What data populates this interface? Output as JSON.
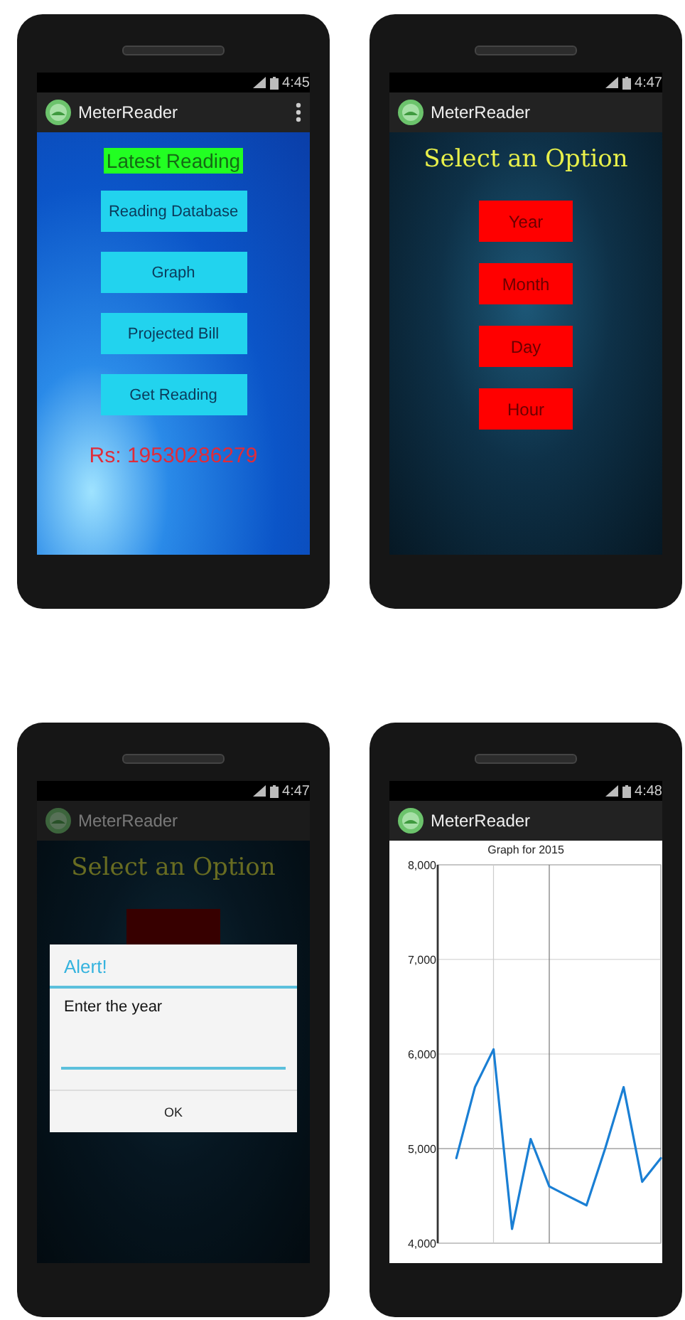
{
  "phones": [
    {
      "kind": "menu",
      "status_time": "4:45",
      "app_title": "MeterReader",
      "overflow_menu": true,
      "heading": "Latest Reading",
      "buttons": [
        "Reading Database",
        "Graph",
        "Projected Bill",
        "Get Reading"
      ],
      "reading": "Rs: 19530286279"
    },
    {
      "kind": "options",
      "status_time": "4:47",
      "app_title": "MeterReader",
      "overflow_menu": false,
      "heading": "Select an Option",
      "options": [
        "Year",
        "Month",
        "Day",
        "Hour"
      ]
    },
    {
      "kind": "dialog",
      "status_time": "4:47",
      "app_title": "MeterReader",
      "overflow_menu": false,
      "dimmed": true,
      "heading": "Select an Option",
      "dialog": {
        "title": "Alert!",
        "message": "Enter the year",
        "button": "OK"
      }
    },
    {
      "kind": "graph",
      "status_time": "4:48",
      "app_title": "MeterReader",
      "overflow_menu": false,
      "chart_data": {
        "type": "line",
        "title": "Graph for 2015",
        "ylim": [
          4000,
          8000
        ],
        "yticks": [
          {
            "value": 4000,
            "label": "4,000"
          },
          {
            "value": 5000,
            "label": "5,000"
          },
          {
            "value": 6000,
            "label": "6,000"
          },
          {
            "value": 7000,
            "label": "7,000"
          },
          {
            "value": 8000,
            "label": "8,000"
          }
        ],
        "grid": true,
        "categories": [
          null,
          null,
          null,
          null,
          null,
          null,
          null,
          null,
          null,
          null,
          null,
          null
        ],
        "series": [
          {
            "color": "#1a7fd4",
            "values": [
              4900,
              5650,
              6050,
              4150,
              5100,
              4600,
              4500,
              4400,
              5000,
              5650,
              4650,
              4900
            ]
          }
        ]
      }
    }
  ]
}
